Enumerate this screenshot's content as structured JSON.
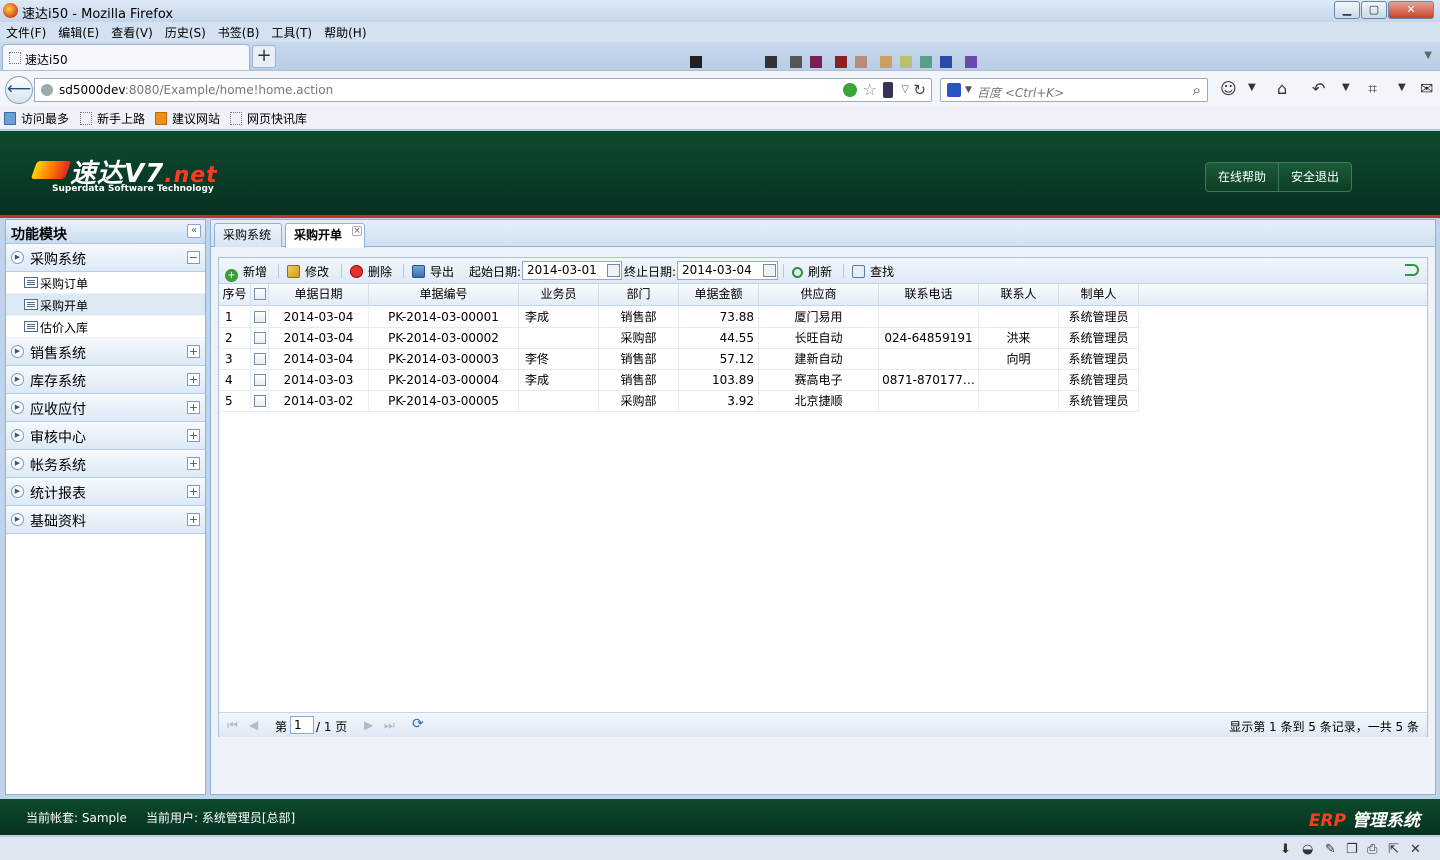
{
  "browser": {
    "window_title": "速达i50 - Mozilla Firefox",
    "menu": [
      "文件(F)",
      "编辑(E)",
      "查看(V)",
      "历史(S)",
      "书签(B)",
      "工具(T)",
      "帮助(H)"
    ],
    "tab_title": "速达i50",
    "url_host": "sd5000dev",
    "url_rest": ":8080/Example/home!home.action",
    "search_placeholder": "百度 <Ctrl+K>",
    "bookmarks": [
      "访问最多",
      "新手上路",
      "建议网站",
      "网页快讯库"
    ]
  },
  "app": {
    "logo_main": "速达V7",
    "logo_suffix": ".net",
    "logo_sub": "Superdata  Software Technology",
    "header_buttons": [
      "在线帮助",
      "安全退出"
    ]
  },
  "sidebar": {
    "title": "功能模块",
    "collapse_glyph": "«",
    "open_module": {
      "label": "采购系统",
      "items": [
        "采购订单",
        "采购开单",
        "估价入库"
      ],
      "selected_index": 1
    },
    "modules": [
      "销售系统",
      "库存系统",
      "应收应付",
      "审核中心",
      "帐务系统",
      "统计报表",
      "基础资料"
    ]
  },
  "main": {
    "tabs": [
      {
        "label": "采购系统",
        "active": false
      },
      {
        "label": "采购开单",
        "active": true
      }
    ],
    "toolbar": {
      "add": "新增",
      "edit": "修改",
      "delete": "删除",
      "export": "导出",
      "start_label": "起始日期:",
      "start_value": "2014-03-01",
      "end_label": "终止日期:",
      "end_value": "2014-03-04",
      "refresh": "刷新",
      "find": "查找"
    },
    "columns": [
      "序号",
      "单据日期",
      "单据编号",
      "业务员",
      "部门",
      "单据金额",
      "供应商",
      "联系电话",
      "联系人",
      "制单人"
    ],
    "rows": [
      {
        "no": "1",
        "date": "2014-03-04",
        "code": "PK-2014-03-00001",
        "clerk": "李成",
        "dept": "销售部",
        "amount": "73.88",
        "supplier": "厦门易用",
        "phone": "",
        "contact": "",
        "maker": "系统管理员"
      },
      {
        "no": "2",
        "date": "2014-03-04",
        "code": "PK-2014-03-00002",
        "clerk": "",
        "dept": "采购部",
        "amount": "44.55",
        "supplier": "长旺自动",
        "phone": "024-64859191",
        "contact": "洪来",
        "maker": "系统管理员"
      },
      {
        "no": "3",
        "date": "2014-03-04",
        "code": "PK-2014-03-00003",
        "clerk": "李佟",
        "dept": "销售部",
        "amount": "57.12",
        "supplier": "建新自动",
        "phone": "",
        "contact": "向明",
        "maker": "系统管理员"
      },
      {
        "no": "4",
        "date": "2014-03-03",
        "code": "PK-2014-03-00004",
        "clerk": "李成",
        "dept": "销售部",
        "amount": "103.89",
        "supplier": "赛高电子",
        "phone": "0871-870177…",
        "contact": "",
        "maker": "系统管理员"
      },
      {
        "no": "5",
        "date": "2014-03-02",
        "code": "PK-2014-03-00005",
        "clerk": "",
        "dept": "采购部",
        "amount": "3.92",
        "supplier": "北京捷顺",
        "phone": "",
        "contact": "",
        "maker": "系统管理员"
      }
    ],
    "pager": {
      "page_prefix": "第",
      "page_value": "1",
      "page_suffix": "/ 1 页",
      "summary": "显示第 1 条到 5 条记录，一共 5 条"
    }
  },
  "footer": {
    "account": "当前帐套: Sample",
    "user": "当前用户: 系统管理员[总部]",
    "brand_erp": "ERP",
    "brand_text": " 管理系统"
  },
  "colors": {
    "header_green": "#0e4a2e",
    "accent_red": "#c0312f",
    "panel_border": "#8eb1d8"
  }
}
